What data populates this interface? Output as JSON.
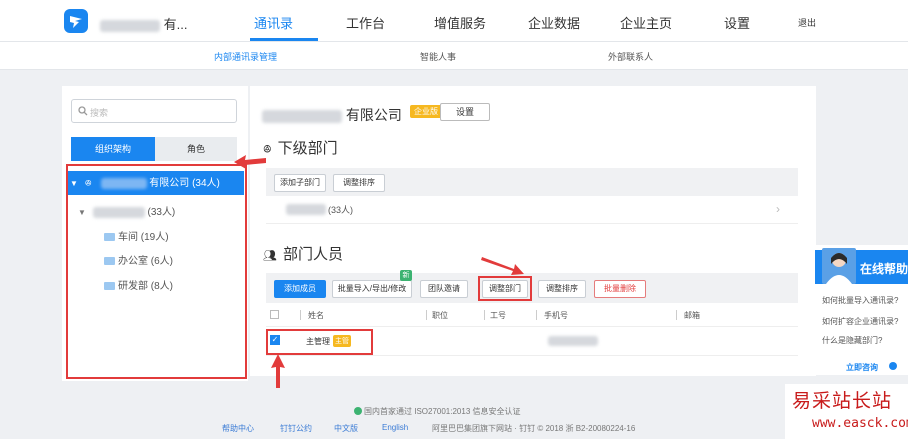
{
  "header": {
    "company_suffix": "有...",
    "nav": [
      "通讯录",
      "工作台",
      "增值服务",
      "企业数据",
      "企业主页",
      "设置",
      "退出"
    ],
    "subnav": [
      "内部通讯录管理",
      "智能人事",
      "外部联系人"
    ]
  },
  "sidebar": {
    "search_placeholder": "搜索",
    "tabs": [
      "组织架构",
      "角色"
    ],
    "root": "有限公司 (34人)",
    "dept": "(33人)",
    "children": [
      "车间 (19人)",
      "办公室 (6人)",
      "研发部 (8人)"
    ]
  },
  "company": {
    "name": "有限公司",
    "badge": "企业版",
    "settings_button": "设置"
  },
  "subdepts": {
    "title": "下级部门",
    "buttons": [
      "添加子部门",
      "调整排序"
    ],
    "row_count": "(33人)"
  },
  "members": {
    "title": "部门人员",
    "buttons": [
      "添加成员",
      "批量导入/导出/修改",
      "团队邀请",
      "调整部门",
      "调整排序",
      "批量删除"
    ],
    "new_badge": "新",
    "headers": [
      "姓名",
      "职位",
      "工号",
      "手机号",
      "邮箱"
    ],
    "row": {
      "name": "主管理",
      "tag": "主管"
    }
  },
  "footer": {
    "security": "国内首家通过 ISO27001:2013 信息安全认证",
    "links": [
      "帮助中心",
      "钉钉公约",
      "中文版",
      "English"
    ],
    "copyright": "阿里巴巴集团旗下网站 · 钉钉 © 2018 浙 B2-20080224-16"
  },
  "help": {
    "title": "在线帮助",
    "questions": [
      "如何批量导入通讯录?",
      "如何扩容企业通讯录?",
      "什么是隐藏部门?"
    ],
    "consult": "立即咨询"
  },
  "watermark": {
    "cn": "易采站长站",
    "url": "www.easck.com"
  },
  "colors": {
    "accent": "#1a86f0",
    "annotation_red": "#e23b3b",
    "badge_yellow": "#f6b820"
  }
}
